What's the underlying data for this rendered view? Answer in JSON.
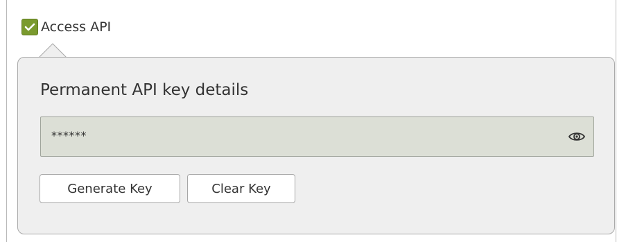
{
  "access": {
    "label": "Access API",
    "checked": true,
    "check_color": "#7a9a2e"
  },
  "panel": {
    "title": "Permanent API key details"
  },
  "key_field": {
    "value": "******",
    "reveal_icon": "eye-icon"
  },
  "buttons": {
    "generate_label": "Generate Key",
    "clear_label": "Clear Key"
  }
}
